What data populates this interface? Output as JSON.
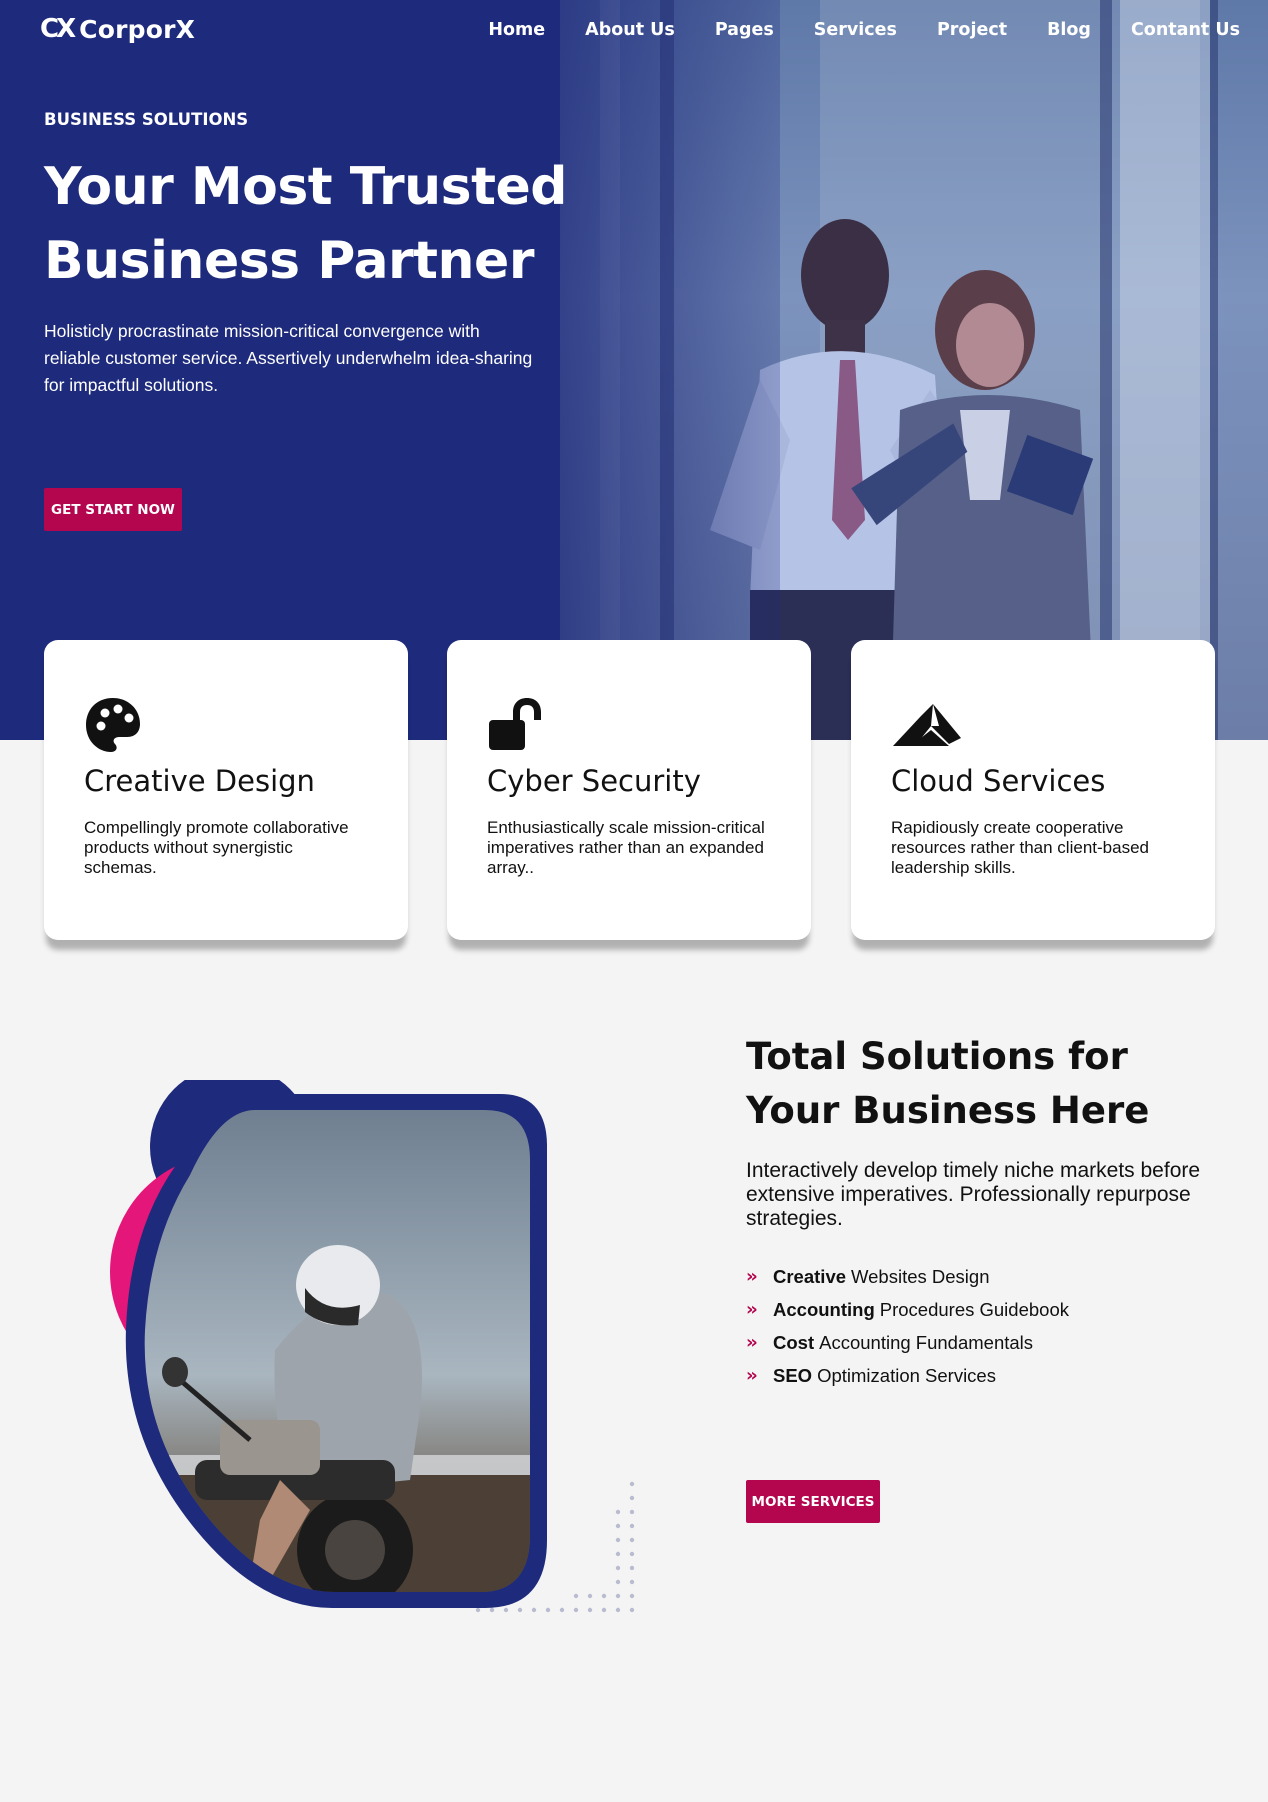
{
  "brand": {
    "logo_mark": "CX",
    "name": "CorporX",
    "accent": "#b4064f",
    "navy": "#1e2a7b"
  },
  "nav": {
    "items": [
      "Home",
      "About Us",
      "Pages",
      "Services",
      "Project",
      "Blog",
      "Contant Us"
    ]
  },
  "hero": {
    "eyebrow": "BUSINESS SOLUTIONS",
    "title_line1": "Your Most Trusted",
    "title_line2": "Business Partner",
    "description": "Holisticly procrastinate mission-critical convergence with reliable customer service. Assertively underwhelm idea-sharing for impactful solutions.",
    "cta": "GET START NOW",
    "image": "two business people looking at a tablet in an office"
  },
  "features": [
    {
      "icon": "palette-icon",
      "title": "Creative Design",
      "text": "Compellingly promote collaborative products without synergistic schemas."
    },
    {
      "icon": "unlock-icon",
      "title": "Cyber Security",
      "text": "Enthusiastically scale mission-critical imperatives rather than an expanded array.."
    },
    {
      "icon": "cloud-mountain-icon",
      "title": "Cloud Services",
      "text": "Rapidiously create cooperative resources rather than client-based leadership skills."
    }
  ],
  "about": {
    "title": "Total Solutions for Your Business Here",
    "description": "Interactively develop timely niche markets before extensive imperatives. Professionally repurpose strategies.",
    "list": [
      {
        "bold": "Creative",
        "rest": "Websites Design"
      },
      {
        "bold": "Accounting",
        "rest": "Procedures Guidebook"
      },
      {
        "bold": "Cost",
        "rest": "Accounting Fundamentals"
      },
      {
        "bold": "SEO",
        "rest": "Optimization Services"
      }
    ],
    "cta": "MORE SERVICES",
    "image": "motorcycle rider in a white helmet on a beach"
  }
}
